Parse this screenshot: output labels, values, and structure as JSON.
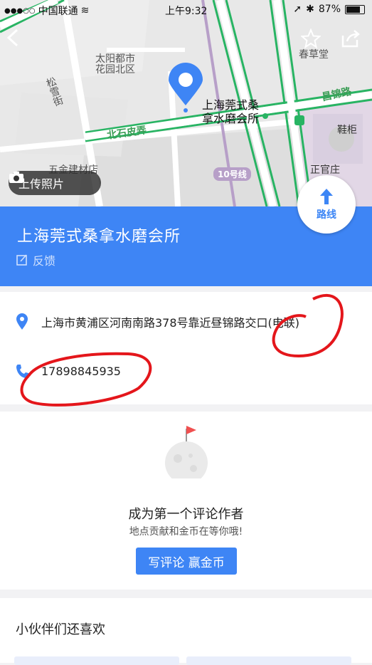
{
  "status_bar": {
    "signal": "●●●○○",
    "carrier": "中国联通",
    "time": "上午9:32",
    "battery": "87%",
    "battery_level": 0.87
  },
  "map": {
    "labels": {
      "taiyang": "太阳都市",
      "taiyang2": "花园北区",
      "songxue": "松雪街",
      "chuncaotang": "春草堂",
      "xiegui": "鞋柜",
      "wujin": "五金建材店",
      "zhengguan": "正官庄",
      "poi_line1": "上海莞式桑",
      "poi_line2": "拿水磨会所"
    },
    "roads": {
      "beishi": "北石皮弄",
      "changjin": "昌锦路",
      "line10": "10号线"
    },
    "upload_label": "上传照片",
    "route_label": "路线"
  },
  "poi": {
    "title": "上海莞式桑拿水磨会所",
    "feedback_label": "反馈",
    "address": "上海市黄浦区河南南路378号靠近昼锦路交口(电联)",
    "phone": "17898845935"
  },
  "review": {
    "title": "成为第一个评论作者",
    "subtitle": "地点贡献和金币在等你哦!",
    "button": "写评论 赢金币"
  },
  "also_like": {
    "title": "小伙伴们还喜欢"
  },
  "colors": {
    "accent": "#3e85f5",
    "road_green": "#28b463",
    "annotation_red": "#e4161b"
  }
}
